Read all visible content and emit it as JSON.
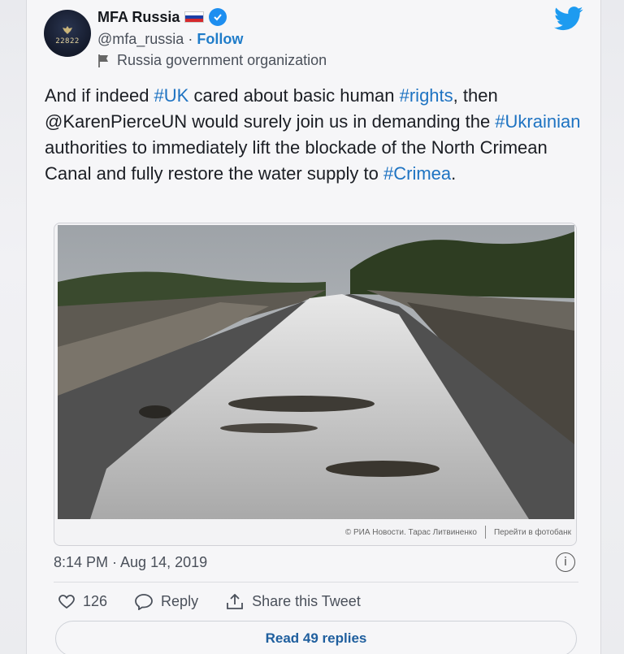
{
  "author": {
    "name": "MFA Russia",
    "avatar_number": "22822",
    "handle": "@mfa_russia",
    "separator": "·",
    "follow_label": "Follow",
    "org_label": "Russia government organization",
    "flag_colors": [
      "#ffffff",
      "#1c3fa6",
      "#d5282c"
    ],
    "verified_color": "#1d8ef0",
    "bird_color": "#1d9bf0"
  },
  "tweet": {
    "segments": [
      {
        "text": "And if indeed ",
        "tag": false
      },
      {
        "text": "#UK",
        "tag": true
      },
      {
        "text": " cared about basic human ",
        "tag": false
      },
      {
        "text": "#rights",
        "tag": true
      },
      {
        "text": ", then @KarenPierceUN would surely join us in demanding the ",
        "tag": false
      },
      {
        "text": "#Ukrainian",
        "tag": true
      },
      {
        "text": " authorities to immediately lift the blockade of the North Crimean Canal and fully restore the water supply to ",
        "tag": false
      },
      {
        "text": "#Crimea",
        "tag": true
      },
      {
        "text": ".",
        "tag": false
      }
    ]
  },
  "media": {
    "credit": "© РИА Новости. Тарас Литвиненко",
    "photobank_link": "Перейти в фотобанк"
  },
  "meta": {
    "timestamp": "8:14 PM · Aug 14, 2019",
    "info_icon": "i"
  },
  "actions": {
    "like_icon": "heart-icon",
    "like_count": "126",
    "reply_icon": "speech-bubble-icon",
    "reply_label": "Reply",
    "share_icon": "share-icon",
    "share_label": "Share this Tweet"
  },
  "footer": {
    "read_replies_label": "Read 49 replies"
  },
  "colors": {
    "link": "#1e73c2",
    "text": "#1b1e24",
    "secondary": "#4a505a"
  }
}
